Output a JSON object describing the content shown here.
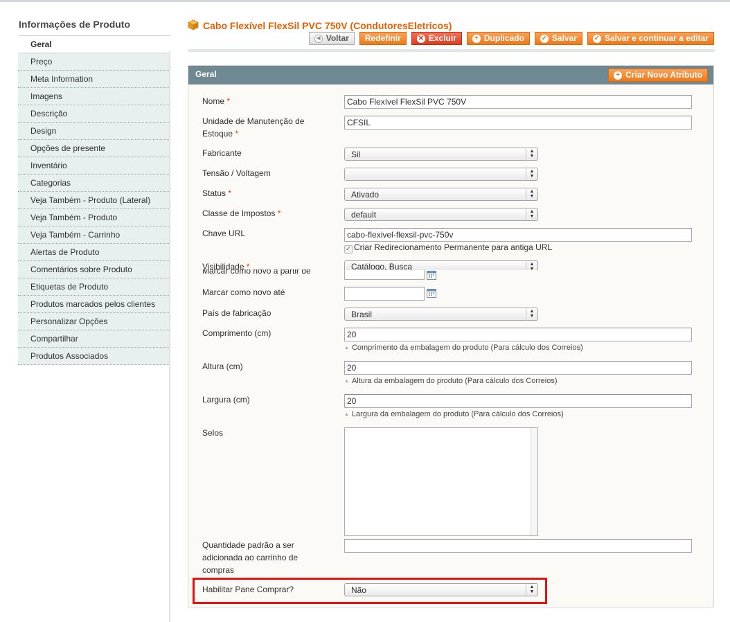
{
  "sidebar": {
    "title": "Informações de Produto",
    "items": [
      {
        "label": "Geral",
        "active": true
      },
      {
        "label": "Preço"
      },
      {
        "label": "Meta Information"
      },
      {
        "label": "Imagens"
      },
      {
        "label": "Descrição"
      },
      {
        "label": "Design"
      },
      {
        "label": "Opções de presente"
      },
      {
        "label": "Inventário"
      },
      {
        "label": "Categorias"
      },
      {
        "label": "Veja Também - Produto (Lateral)"
      },
      {
        "label": "Veja Também - Produto"
      },
      {
        "label": "Veja Também - Carrinho"
      },
      {
        "label": "Alertas de Produto"
      },
      {
        "label": "Comentários sobre Produto"
      },
      {
        "label": "Etiquetas de Produto"
      },
      {
        "label": "Produtos marcados pelos clientes"
      },
      {
        "label": "Personalizar Opções"
      },
      {
        "label": "Compartilhar"
      },
      {
        "label": "Produtos Associados"
      }
    ]
  },
  "header": {
    "title": "Cabo Flexível FlexSil PVC 750V (CondutoresEletricos)",
    "buttons": {
      "back": "Voltar",
      "reset": "Redefinir",
      "delete": "Excluir",
      "duplicate": "Duplicado",
      "save": "Salvar",
      "save_continue": "Salvar e continuar a editar"
    }
  },
  "section": {
    "title": "Geral",
    "create_attribute": "Criar Novo Atributo"
  },
  "form": {
    "required_mark": "*",
    "name": {
      "label": "Nome",
      "value": "Cabo Flexível FlexSil PVC 750V"
    },
    "sku": {
      "label": "Unidade de Manutenção de Estoque",
      "value": "CFSIL"
    },
    "manufacturer": {
      "label": "Fabricante",
      "value": "Sil"
    },
    "voltage": {
      "label": "Tensão / Voltagem",
      "value": ""
    },
    "status": {
      "label": "Status",
      "value": "Ativado"
    },
    "tax_class": {
      "label": "Classe de Impostos",
      "value": "default"
    },
    "url_key": {
      "label": "Chave URL",
      "value": "cabo-flexivel-flexsil-pvc-750v",
      "redirect_label": "Criar Redirecionamento Permanente para antiga URL",
      "redirect_checked": true
    },
    "visibility": {
      "label": "Visibilidade",
      "value": "Catálogo, Busca"
    },
    "new_from": {
      "label": "Marcar como novo a partir de",
      "value": ""
    },
    "new_to": {
      "label": "Marcar como novo até",
      "value": ""
    },
    "country": {
      "label": "País de fabricação",
      "value": "Brasil"
    },
    "length": {
      "label": "Comprimento (cm)",
      "value": "20",
      "note": "Comprimento da embalagem do produto (Para cálculo dos Correios)"
    },
    "height": {
      "label": "Altura (cm)",
      "value": "20",
      "note": "Altura da embalagem do produto (Para cálculo dos Correios)"
    },
    "width": {
      "label": "Largura (cm)",
      "value": "20",
      "note": "Largura da embalagem do produto (Para cálculo dos Correios)"
    },
    "seals": {
      "label": "Selos"
    },
    "default_qty": {
      "label": "Quantidade padrão a ser adicionada ao carrinho de compras",
      "value": ""
    },
    "buy_pane": {
      "label": "Habilitar Pane Comprar?",
      "value": "Não"
    }
  },
  "colors": {
    "accent": "#eb5e00",
    "header_bar": "#6f8992",
    "highlight": "#e8110f"
  }
}
